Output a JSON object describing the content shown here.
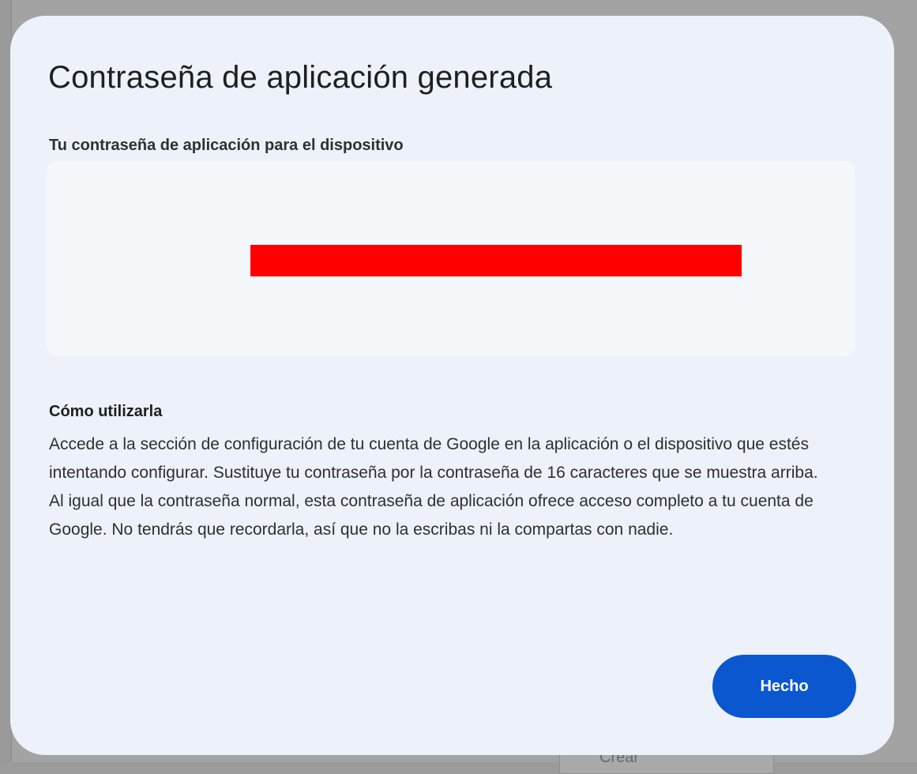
{
  "background": {
    "partial_button_label": "Crear"
  },
  "dialog": {
    "title": "Contraseña de aplicación generada",
    "password_section_label": "Tu contraseña de aplicación para el dispositivo",
    "password_value": "",
    "howto": {
      "heading": "Cómo utilizarla",
      "paragraphs": [
        "Accede a la sección de configuración de tu cuenta de Google en la aplicación o el dispositivo que estés intentando configurar. Sustituye tu contraseña por la contraseña de 16 caracteres que se muestra arriba.",
        "Al igual que la contraseña normal, esta contraseña de aplicación ofrece acceso completo a tu cuenta de Google. No tendrás que recordarla, así que no la escribas ni la compartas con nadie."
      ]
    },
    "done_button_label": "Hecho"
  },
  "colors": {
    "primary_button": "#0b57d0",
    "dialog_background": "#edf1fa",
    "password_box_background": "#f4f8fb",
    "redaction": "#ff0000"
  }
}
